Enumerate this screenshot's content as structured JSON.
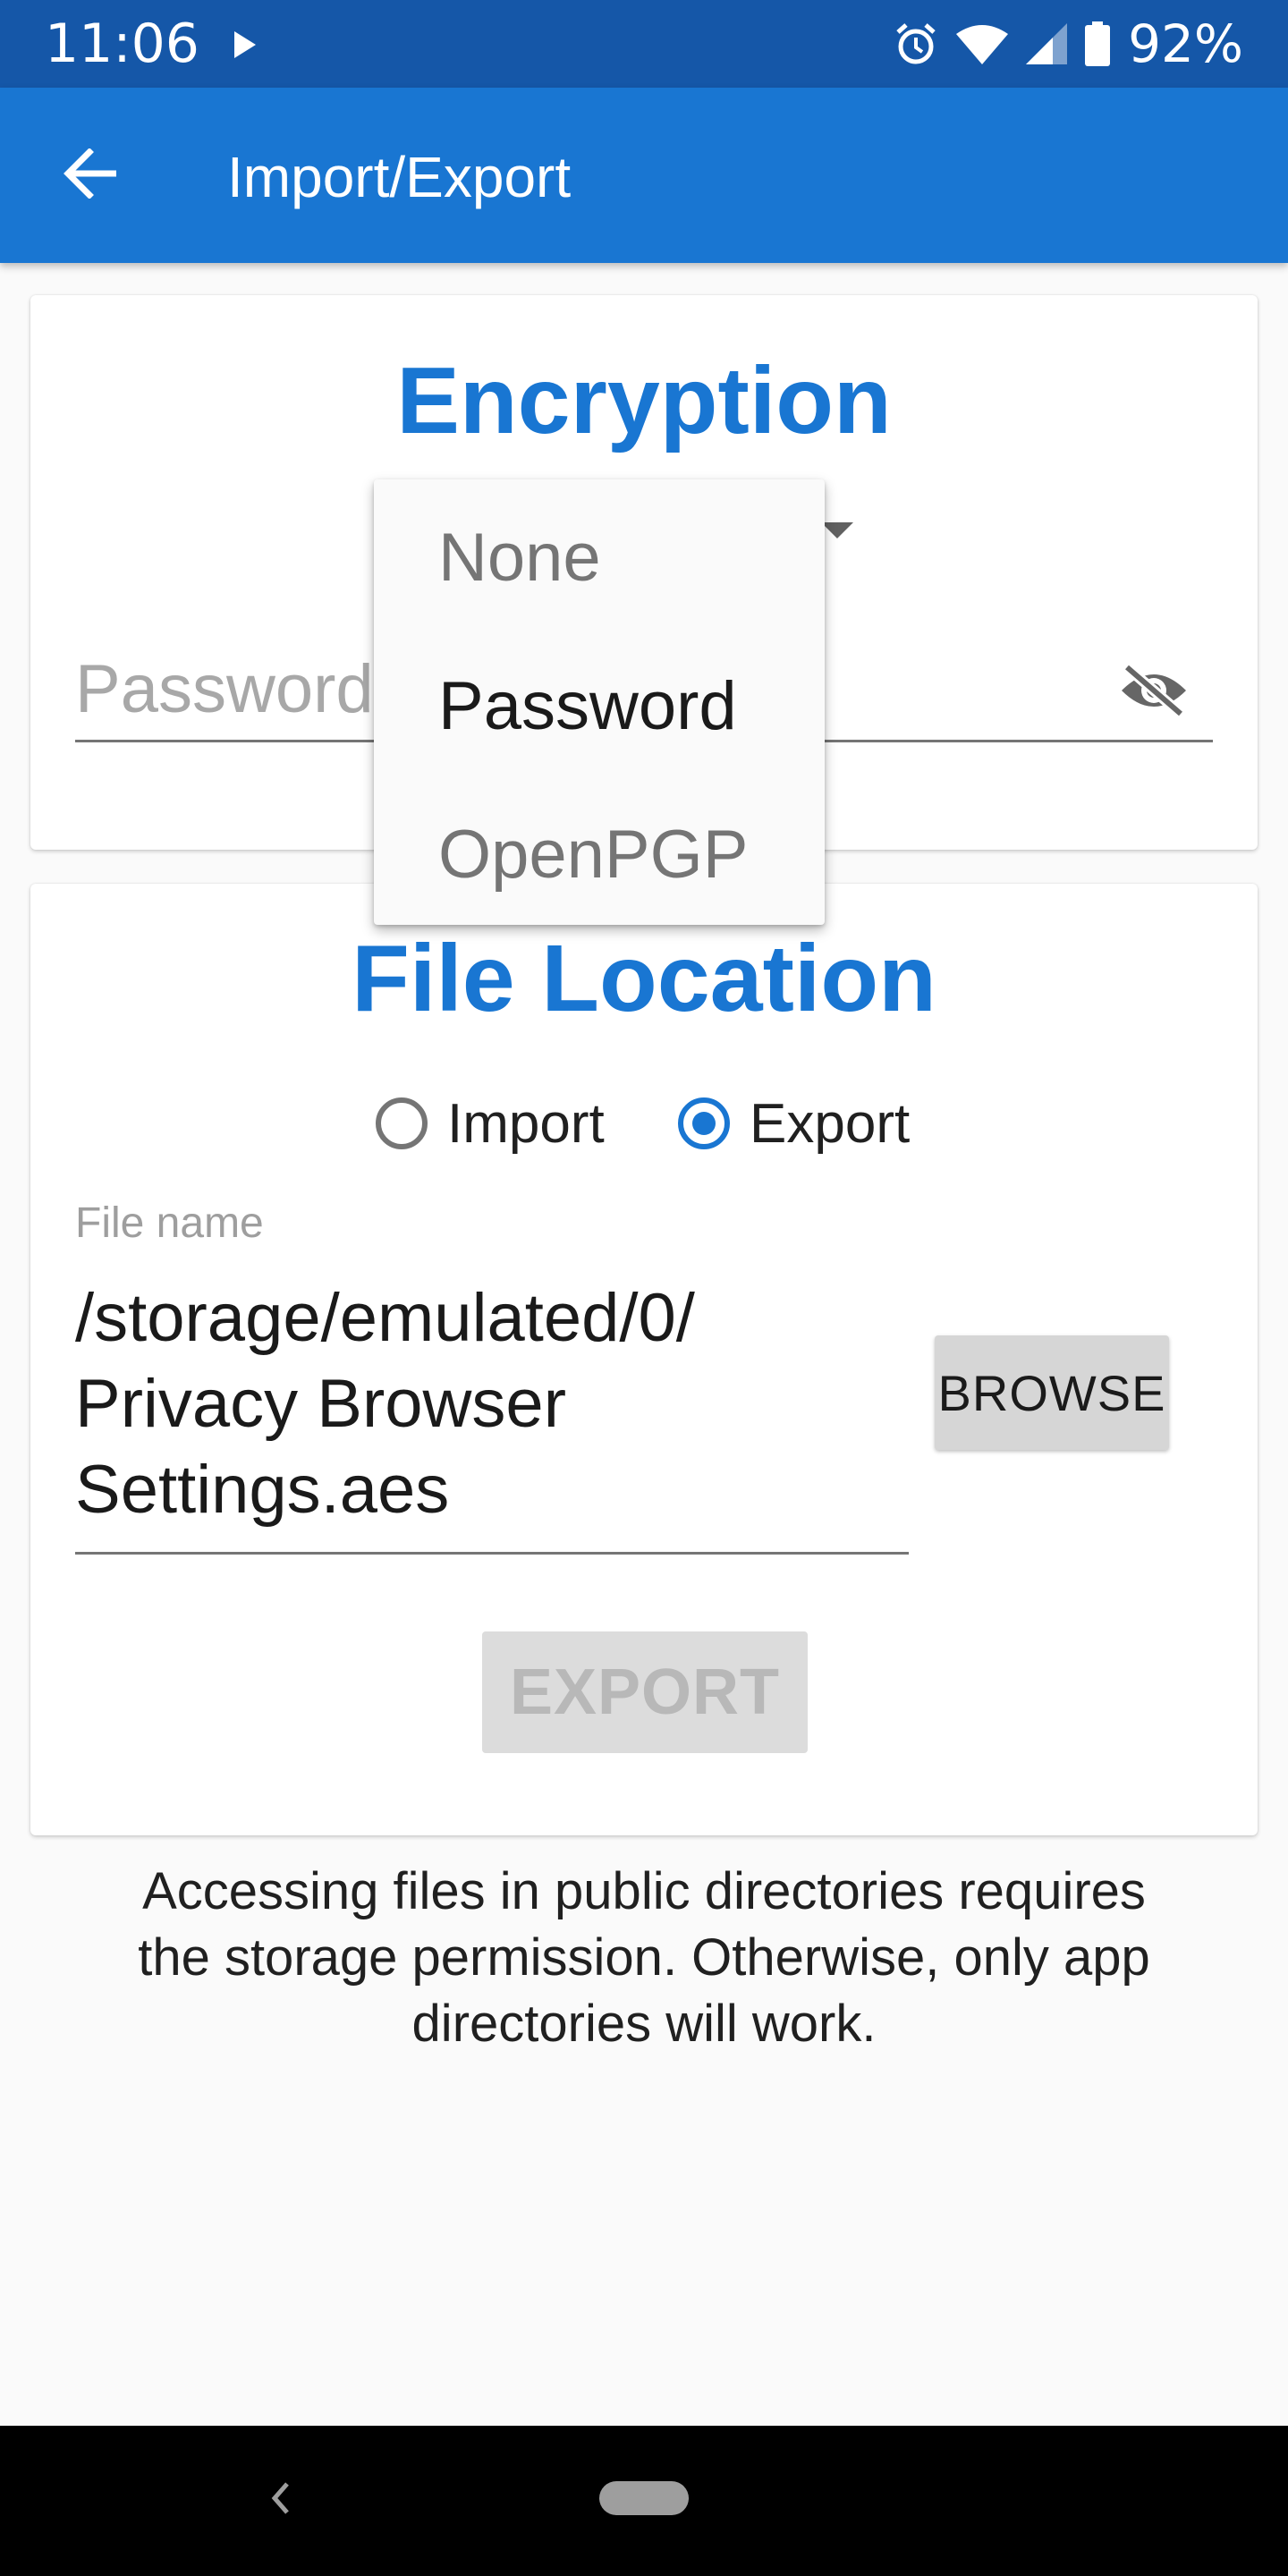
{
  "status_bar": {
    "time": "11:06",
    "battery": "92%",
    "icons": [
      "play-icon",
      "alarm-icon",
      "wifi-icon",
      "signal-icon",
      "battery-icon"
    ]
  },
  "app_bar": {
    "title": "Import/Export",
    "back_icon": "arrow-left-icon"
  },
  "encryption": {
    "title": "Encryption",
    "password_placeholder": "Password",
    "visibility_icon": "eye-off-icon",
    "dropdown": {
      "options": [
        "None",
        "Password",
        "OpenPGP"
      ],
      "selected": "Password"
    }
  },
  "file_location": {
    "title": "File Location",
    "radio": {
      "import_label": "Import",
      "export_label": "Export",
      "selected": "Export"
    },
    "file_name_label": "File name",
    "file_name_value": "/storage/emulated/0/\nPrivacy Browser\nSettings.aes",
    "browse_label": "BROWSE",
    "export_label": "EXPORT"
  },
  "note": "Accessing files in public directories requires\nthe storage permission. Otherwise, only app\ndirectories will work.",
  "colors": {
    "status_bar": "#1557a8",
    "app_bar": "#1976d2",
    "accent": "#1976d2"
  }
}
